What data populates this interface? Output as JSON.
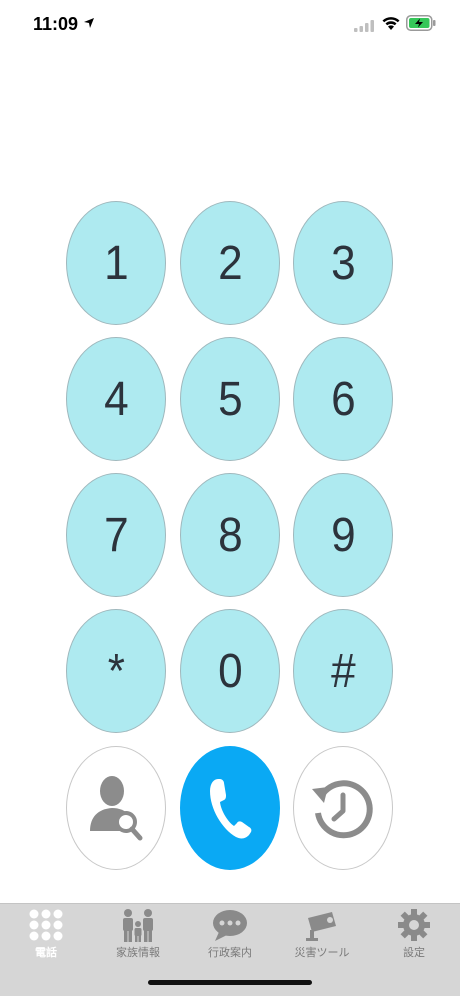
{
  "status_bar": {
    "time": "11:09",
    "icons": [
      "location-arrow-icon",
      "signal-icon",
      "wifi-icon",
      "battery-charging-icon"
    ]
  },
  "keypad": {
    "keys": [
      "1",
      "2",
      "3",
      "4",
      "5",
      "6",
      "7",
      "8",
      "9",
      "*",
      "0",
      "#"
    ],
    "key_color": "#aeeaf0",
    "action_buttons": {
      "contacts_search": "contact-search-icon",
      "call": "phone-icon",
      "history": "history-clock-icon"
    },
    "call_color": "#0aa9f4"
  },
  "tab_bar": {
    "tabs": [
      {
        "label": "電話",
        "icon": "keypad-grid-icon",
        "active": true
      },
      {
        "label": "家族情報",
        "icon": "family-icon",
        "active": false
      },
      {
        "label": "行政案内",
        "icon": "speech-bubble-icon",
        "active": false
      },
      {
        "label": "災害ツール",
        "icon": "disaster-camera-icon",
        "active": false
      },
      {
        "label": "設定",
        "icon": "gear-icon",
        "active": false
      }
    ]
  }
}
